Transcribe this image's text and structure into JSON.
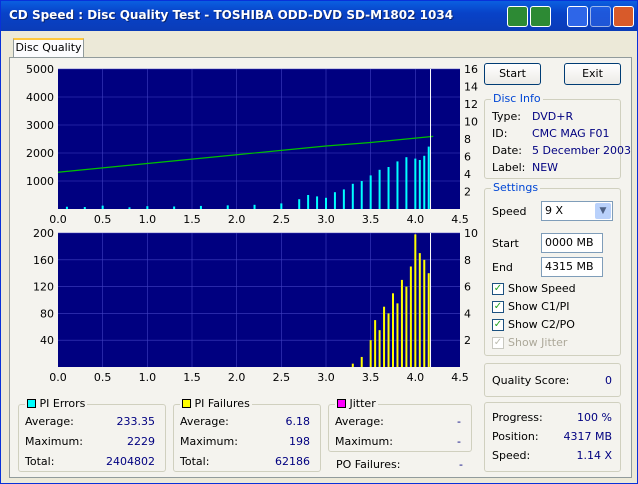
{
  "window": {
    "title": "CD Speed : Disc Quality Test - TOSHIBA ODD-DVD SD-M1802 1034"
  },
  "tab": {
    "label": "Disc Quality"
  },
  "buttons": {
    "start": "Start",
    "exit": "Exit"
  },
  "disc_info": {
    "title": "Disc Info",
    "rows": [
      {
        "label": "Type:",
        "value": "DVD+R"
      },
      {
        "label": "ID:",
        "value": "CMC MAG F01"
      },
      {
        "label": "Date:",
        "value": "5 December 2003"
      },
      {
        "label": "Label:",
        "value": "NEW"
      }
    ]
  },
  "settings": {
    "title": "Settings",
    "speed_label": "Speed",
    "speed_value": "9 X",
    "start_label": "Start",
    "start_value": "0000 MB",
    "end_label": "End",
    "end_value": "4315 MB",
    "checks": [
      {
        "label": "Show Speed",
        "checked": true,
        "disabled": false
      },
      {
        "label": "Show C1/PI",
        "checked": true,
        "disabled": false
      },
      {
        "label": "Show C2/PO",
        "checked": true,
        "disabled": false
      },
      {
        "label": "Show Jitter",
        "checked": true,
        "disabled": true
      }
    ]
  },
  "quality": {
    "label": "Quality Score:",
    "value": "0"
  },
  "progress": {
    "rows": [
      {
        "label": "Progress:",
        "value": "100 %"
      },
      {
        "label": "Position:",
        "value": "4317 MB"
      },
      {
        "label": "Speed:",
        "value": "1.14 X"
      }
    ]
  },
  "pi_errors": {
    "title": "PI Errors",
    "color": "#00ffff",
    "rows": [
      {
        "label": "Average:",
        "value": "233.35"
      },
      {
        "label": "Maximum:",
        "value": "2229"
      },
      {
        "label": "Total:",
        "value": "2404802"
      }
    ]
  },
  "pi_failures": {
    "title": "PI Failures",
    "color": "#ffff00",
    "rows": [
      {
        "label": "Average:",
        "value": "6.18"
      },
      {
        "label": "Maximum:",
        "value": "198"
      },
      {
        "label": "Total:",
        "value": "62186"
      }
    ]
  },
  "jitter": {
    "title": "Jitter",
    "color": "#ff00ff",
    "rows": [
      {
        "label": "Average:",
        "value": "-"
      },
      {
        "label": "Maximum:",
        "value": "-"
      }
    ],
    "po_label": "PO Failures:",
    "po_value": "-"
  },
  "chart_data": [
    {
      "type": "bar",
      "series": [
        {
          "values_x": [
            0.1,
            0.3,
            0.5,
            0.8,
            1.0,
            1.3,
            1.6,
            1.9,
            2.2,
            2.5,
            2.7,
            2.8,
            2.9,
            3.0,
            3.1,
            3.2,
            3.3,
            3.4,
            3.5,
            3.6,
            3.7,
            3.8,
            3.9,
            4.0,
            4.05,
            4.1,
            4.15
          ],
          "values": [
            80,
            70,
            120,
            60,
            100,
            90,
            110,
            130,
            150,
            200,
            350,
            500,
            450,
            400,
            600,
            700,
            900,
            1000,
            1200,
            1400,
            1500,
            1700,
            1850,
            1800,
            1750,
            1900,
            2229
          ]
        },
        {
          "speed_x": [
            0.0,
            0.5,
            1.0,
            1.5,
            2.0,
            2.5,
            3.0,
            3.5,
            4.0,
            4.2
          ],
          "speed_values": [
            4.2,
            4.7,
            5.2,
            5.7,
            6.2,
            6.7,
            7.2,
            7.6,
            8.1,
            8.3
          ]
        }
      ],
      "x_ticks": [
        "0.0",
        "0.5",
        "1.0",
        "1.5",
        "2.0",
        "2.5",
        "3.0",
        "3.5",
        "4.0",
        "4.5"
      ],
      "y_ticks_left": [
        "5000",
        "4000",
        "3000",
        "2000",
        "1000"
      ],
      "y_ticks_right": [
        "16",
        "14",
        "12",
        "10",
        "8",
        "6",
        "4",
        "2"
      ],
      "xlim": [
        0,
        4.5
      ],
      "ylim": [
        0,
        5000
      ],
      "y2lim": [
        0,
        16
      ],
      "bar_color": "#00ffff",
      "line_color": "#00c000",
      "grid": true
    },
    {
      "type": "bar",
      "series": [
        {
          "values_x": [
            3.3,
            3.4,
            3.5,
            3.55,
            3.6,
            3.65,
            3.7,
            3.75,
            3.8,
            3.85,
            3.9,
            3.95,
            4.0,
            4.05,
            4.1,
            4.15
          ],
          "values": [
            5,
            15,
            40,
            70,
            55,
            90,
            80,
            110,
            95,
            130,
            120,
            150,
            198,
            170,
            160,
            140
          ]
        }
      ],
      "x_ticks": [
        "0.0",
        "0.5",
        "1.0",
        "1.5",
        "2.0",
        "2.5",
        "3.0",
        "3.5",
        "4.0",
        "4.5"
      ],
      "y_ticks_left": [
        "200",
        "160",
        "120",
        "80",
        "40"
      ],
      "y_ticks_right": [
        "10",
        "8",
        "6",
        "4",
        "2"
      ],
      "xlim": [
        0,
        4.5
      ],
      "ylim": [
        0,
        200
      ],
      "y2lim": [
        0,
        10
      ],
      "bar_color": "#ffff00",
      "grid": true
    }
  ]
}
